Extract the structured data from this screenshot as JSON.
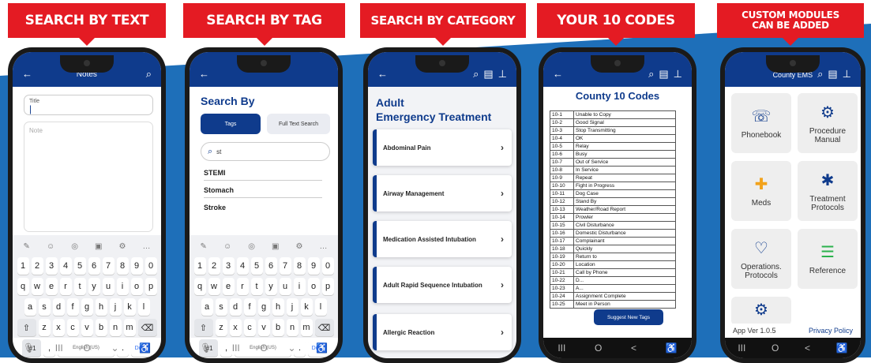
{
  "colors": {
    "banner": "#e41b23",
    "appbar": "#0f3b8c",
    "background_stripe": "#1e6fb9"
  },
  "banners": [
    "SEARCH BY TEXT",
    "SEARCH BY TAG",
    "SEARCH BY CATEGORY",
    "YOUR 10 CODES",
    "CUSTOM MODULES CAN BE ADDED"
  ],
  "notes": {
    "title": "Notes",
    "title_label": "Title",
    "note_placeholder": "Note"
  },
  "keyboard": {
    "tools": [
      "mic-icon",
      "emoji-icon",
      "sticker-icon",
      "clipboard-icon",
      "gear-icon",
      "…"
    ],
    "row1": [
      "1",
      "2",
      "3",
      "4",
      "5",
      "6",
      "7",
      "8",
      "9",
      "0"
    ],
    "row2": [
      "q",
      "w",
      "e",
      "r",
      "t",
      "y",
      "u",
      "i",
      "o",
      "p"
    ],
    "row3": [
      "a",
      "s",
      "d",
      "f",
      "g",
      "h",
      "j",
      "k",
      "l"
    ],
    "row4": [
      "z",
      "x",
      "c",
      "v",
      "b",
      "n",
      "m"
    ],
    "symbols": "!#1",
    "comma": ",",
    "space": "English (US)",
    "period": ".",
    "done": "Done"
  },
  "tag": {
    "heading": "Search By",
    "tab_tags": "Tags",
    "tab_full": "Full Text Search",
    "query": "st",
    "results": [
      "STEMI",
      "Stomach",
      "Stroke"
    ]
  },
  "category": {
    "heading1": "Adult",
    "heading2": "Emergency Treatment",
    "items": [
      "Abdominal Pain",
      "Airway Management",
      "Medication Assisted Intubation",
      "Adult Rapid Sequence Intubation",
      "Allergic Reaction"
    ]
  },
  "codes": {
    "heading": "County 10 Codes",
    "suggest": "Suggest New Tags",
    "rows": [
      [
        "10-1",
        "Unable to Copy"
      ],
      [
        "10-2",
        "Good Signal"
      ],
      [
        "10-3",
        "Stop Transmitting"
      ],
      [
        "10-4",
        "OK"
      ],
      [
        "10-5",
        "Relay"
      ],
      [
        "10-6",
        "Busy"
      ],
      [
        "10-7",
        "Out of Service"
      ],
      [
        "10-8",
        "In Service"
      ],
      [
        "10-9",
        "Repeat"
      ],
      [
        "10-10",
        "Fight in Progress"
      ],
      [
        "10-11",
        "Dog Case"
      ],
      [
        "10-12",
        "Stand By"
      ],
      [
        "10-13",
        "Weather/Road Report"
      ],
      [
        "10-14",
        "Prowler"
      ],
      [
        "10-15",
        "Civil Disturbance"
      ],
      [
        "10-16",
        "Domestic Disturbance"
      ],
      [
        "10-17",
        "Complainant"
      ],
      [
        "10-18",
        "Quickly"
      ],
      [
        "10-19",
        "Return to"
      ],
      [
        "10-20",
        "Location"
      ],
      [
        "10-21",
        "Call by Phone"
      ],
      [
        "10-22",
        "D..."
      ],
      [
        "10-23",
        "A..."
      ],
      [
        "10-24",
        "Assignment Complete"
      ],
      [
        "10-25",
        "Meet in Person"
      ]
    ]
  },
  "modules": {
    "app_title": "County EMS",
    "tiles": [
      "Phonebook",
      "Procedure Manual",
      "Meds",
      "Treatment Protocols",
      "Operations. Protocols",
      "Reference"
    ],
    "version": "App Ver 1.0.5",
    "privacy": "Privacy Policy"
  },
  "navbar": {
    "recent": "III",
    "home": "O",
    "back": "<",
    "access": "accessibility-icon"
  }
}
